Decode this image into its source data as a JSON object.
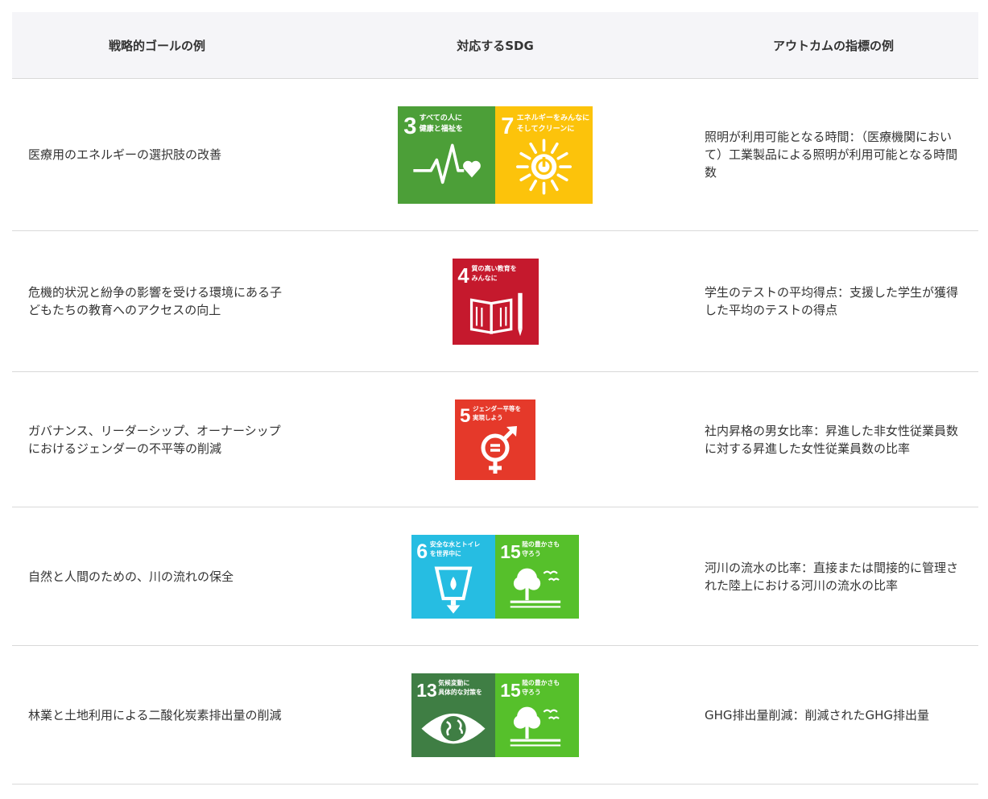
{
  "header": {
    "col1": "戦略的ゴールの例",
    "col2": "対応するSDG",
    "col3": "アウトカムの指標の例"
  },
  "rows": [
    {
      "goal": "医療用のエネルギーの選択肢の改善",
      "sdgs": [
        {
          "num": "3",
          "line1": "すべての人に",
          "line2": "健康と福祉を",
          "color": "#4c9f38",
          "icon": "heartbeat-icon"
        },
        {
          "num": "7",
          "line1": "エネルギーをみんなに",
          "line2": "そしてクリーンに",
          "color": "#fcc30b",
          "icon": "sun-power-icon"
        }
      ],
      "outcome": "照明が利用可能となる時間：（医療機関において）工業製品による照明が利用可能となる時間数"
    },
    {
      "goal": "危機的状況と紛争の影響を受ける環境にある子どもたちの教育へのアクセスの向上",
      "sdgs": [
        {
          "num": "4",
          "line1": "質の高い教育を",
          "line2": "みんなに",
          "color": "#c5192d",
          "icon": "book-pencil-icon"
        }
      ],
      "outcome": "学生のテストの平均得点：支援した学生が獲得した平均のテストの得点"
    },
    {
      "goal": "ガバナンス、リーダーシップ、オーナーシップにおけるジェンダーの不平等の削減",
      "sdgs": [
        {
          "num": "5",
          "line1": "ジェンダー平等を",
          "line2": "実現しよう",
          "color": "#e5392a",
          "icon": "gender-equality-icon"
        }
      ],
      "outcome": "社内昇格の男女比率：昇進した非女性従業員数に対する昇進した女性従業員数の比率"
    },
    {
      "goal": "自然と人間のための、川の流れの保全",
      "sdgs": [
        {
          "num": "6",
          "line1": "安全な水とトイレ",
          "line2": "を世界中に",
          "color": "#26bde2",
          "icon": "water-glass-icon"
        },
        {
          "num": "15",
          "line1": "陸の豊かさも",
          "line2": "守ろう",
          "color": "#56c02b",
          "icon": "tree-birds-icon"
        }
      ],
      "outcome": "河川の流水の比率：直接または間接的に管理された陸上における河川の流水の比率"
    },
    {
      "goal": "林業と土地利用による二酸化炭素排出量の削減",
      "sdgs": [
        {
          "num": "13",
          "line1": "気候変動に",
          "line2": "具体的な対策を",
          "color": "#3f7e44",
          "icon": "earth-eye-icon"
        },
        {
          "num": "15",
          "line1": "陸の豊かさも",
          "line2": "守ろう",
          "color": "#56c02b",
          "icon": "tree-birds-icon"
        }
      ],
      "outcome": "GHG排出量削減：削減されたGHG排出量"
    }
  ]
}
